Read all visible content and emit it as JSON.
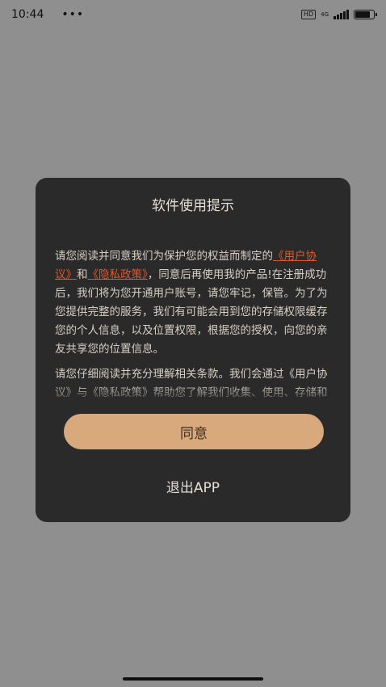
{
  "status_bar": {
    "time": "10:44",
    "menu_dots": "•••",
    "hd_badge": "HD",
    "network_type": "4G",
    "signal_strength": 4,
    "battery_level": 0.9
  },
  "dialog": {
    "title": "软件使用提示",
    "paragraph1": {
      "prefix": "请您阅读并同意我们为保护您的权益而制定的",
      "link_user_agreement": "《用户协议》",
      "and": "和",
      "link_privacy_policy": "《隐私政策》",
      "suffix": "，同意后再使用我的产品!在注册成功后，我们将为您开通用户账号，请您牢记，保管。为了为您提供完整的服务，我们有可能会用到您的存储权限缓存您的个人信息，以及位置权限，根据您的授权，向您的亲友共享您的位置信息。"
    },
    "paragraph2": "请您仔细阅读并充分理解相关条款。我们会通过《用户协议》与《隐私政策》帮助您了解我们收集、使用、存储和共享您位置信息的情况，以及您",
    "agree_label": "同意",
    "exit_label": "退出APP"
  },
  "colors": {
    "overlay": "#8f8f8f",
    "dialog_bg": "#2a2a2a",
    "accent_button": "#d8a97c",
    "link": "#e0572b"
  }
}
